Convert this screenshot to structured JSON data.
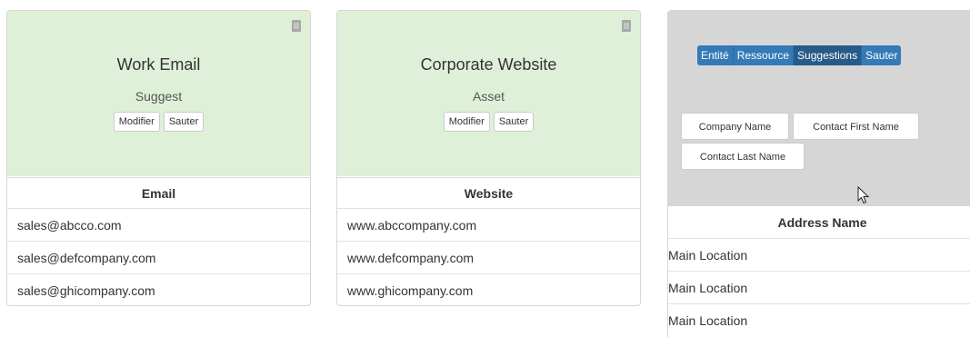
{
  "cards": [
    {
      "title": "Work Email",
      "subtitle": "Suggest",
      "buttons": [
        "Modifier",
        "Sauter"
      ],
      "column_header": "Email",
      "rows": [
        "sales@abcco.com",
        "sales@defcompany.com",
        "sales@ghicompany.com"
      ]
    },
    {
      "title": "Corporate Website",
      "subtitle": "Asset",
      "buttons": [
        "Modifier",
        "Sauter"
      ],
      "column_header": "Website",
      "rows": [
        "www.abccompany.com",
        "www.defcompany.com",
        "www.ghicompany.com"
      ]
    },
    {
      "tabs": [
        "Entité",
        "Ressource",
        "Suggestions",
        "Sauter"
      ],
      "active_tab": "Suggestions",
      "chips": [
        "Company Name",
        "Contact First Name",
        "Contact Last Name"
      ],
      "column_header": "Address Name",
      "rows": [
        "Main Location",
        "Main Location",
        "Main Location"
      ]
    }
  ],
  "icons": {
    "delete": "trash-icon",
    "cursor": "mouse-pointer-icon"
  },
  "colors": {
    "header_green": "#dff0d8",
    "header_gray": "#d6d6d6",
    "tab_blue": "#337ab7",
    "tab_active": "#265a88"
  }
}
